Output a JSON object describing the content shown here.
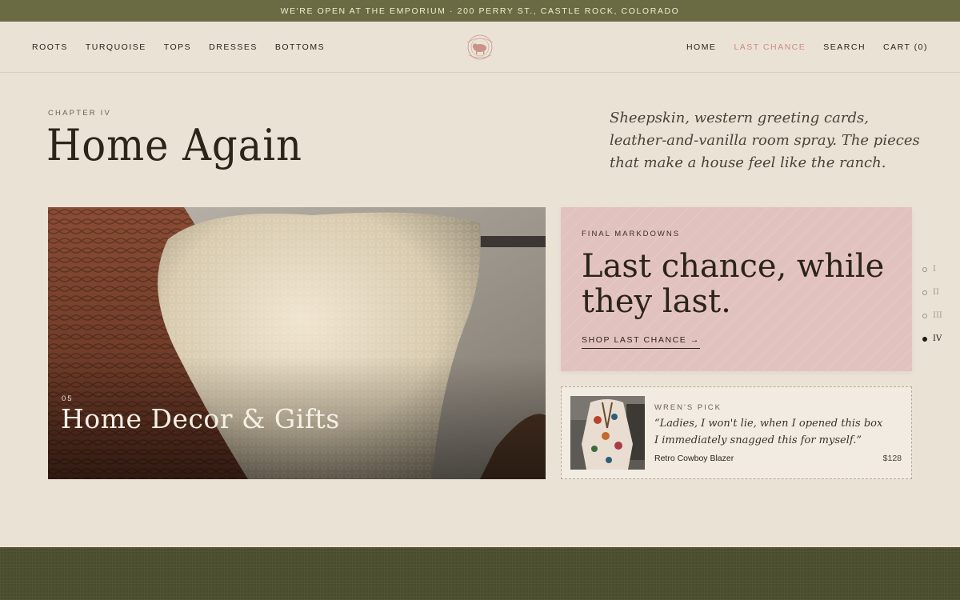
{
  "announcement": "WE'RE OPEN AT THE EMPORIUM · 200 PERRY ST., CASTLE ROCK, COLORADO",
  "nav_left": [
    "ROOTS",
    "TURQUOISE",
    "TOPS",
    "DRESSES",
    "BOTTOMS"
  ],
  "nav_right": {
    "home": "HOME",
    "last_chance": "LAST CHANCE",
    "search": "SEARCH",
    "cart": "CART (0)"
  },
  "colors": {
    "announce_bg": "#6a6b42",
    "page_bg": "#ebe2d6",
    "accent": "#c98d84",
    "promo_bg": "#e2c2bf",
    "footer_bg": "#4a4c2e"
  },
  "logo_icon": "bison-seal-logo",
  "chapter": {
    "label": "CHAPTER IV",
    "title": "Home Again",
    "intro": "Sheepskin, western greeting cards, leather-and-vanilla room spray. The pieces that make a house feel like the ranch."
  },
  "hero": {
    "number": "05",
    "title": "Home Decor & Gifts",
    "image": "sheepskin-pillow-photo"
  },
  "promo": {
    "kicker": "FINAL MARKDOWNS",
    "title": "Last chance, while they last.",
    "cta": "SHOP LAST CHANCE →"
  },
  "pick": {
    "kicker": "WREN'S PICK",
    "quote": "“Ladies, I won't lie, when I opened this box I immediately snagged this for myself.”",
    "name": "Retro Cowboy Blazer",
    "price": "$128",
    "image": "cowboy-blazer-photo"
  },
  "chapter_nav": [
    "I",
    "II",
    "III",
    "IV"
  ],
  "chapter_nav_active": "IV"
}
